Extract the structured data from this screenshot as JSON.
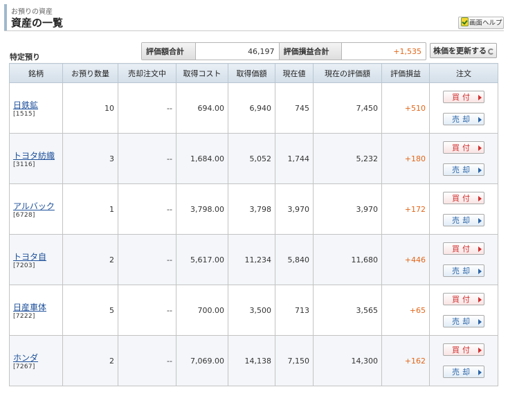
{
  "header": {
    "subtitle": "お預りの資産",
    "title": "資産の一覧",
    "help_label": "画面ヘルプ"
  },
  "section_label": "特定預り",
  "summary": {
    "valuation_total_label": "評価額合計",
    "valuation_total_value": "46,197",
    "pl_total_label": "評価損益合計",
    "pl_total_value": "+1,535"
  },
  "refresh_label": "株価を更新する",
  "colors": {
    "profit": "#e2661a",
    "link": "#1d4f9a",
    "buy": "#d03030",
    "sell": "#2a64a8"
  },
  "table": {
    "headers": [
      "銘柄",
      "お預り数量",
      "売却注文中",
      "取得コスト",
      "取得価額",
      "現在値",
      "現在の評価額",
      "評価損益",
      "注文"
    ],
    "buy_label": "買付",
    "sell_label": "売却",
    "rows": [
      {
        "name": "日鉄鉱",
        "code": "[1515]",
        "qty": "10",
        "pending": "--",
        "cost": "694.00",
        "acq_value": "6,940",
        "price": "745",
        "valuation": "7,450",
        "pl": "+510"
      },
      {
        "name": "トヨタ紡織",
        "code": "[3116]",
        "qty": "3",
        "pending": "--",
        "cost": "1,684.00",
        "acq_value": "5,052",
        "price": "1,744",
        "valuation": "5,232",
        "pl": "+180"
      },
      {
        "name": "アルバック",
        "code": "[6728]",
        "qty": "1",
        "pending": "--",
        "cost": "3,798.00",
        "acq_value": "3,798",
        "price": "3,970",
        "valuation": "3,970",
        "pl": "+172"
      },
      {
        "name": "トヨタ自",
        "code": "[7203]",
        "qty": "2",
        "pending": "--",
        "cost": "5,617.00",
        "acq_value": "11,234",
        "price": "5,840",
        "valuation": "11,680",
        "pl": "+446"
      },
      {
        "name": "日産車体",
        "code": "[7222]",
        "qty": "5",
        "pending": "--",
        "cost": "700.00",
        "acq_value": "3,500",
        "price": "713",
        "valuation": "3,565",
        "pl": "+65"
      },
      {
        "name": "ホンダ",
        "code": "[7267]",
        "qty": "2",
        "pending": "--",
        "cost": "7,069.00",
        "acq_value": "14,138",
        "price": "7,150",
        "valuation": "14,300",
        "pl": "+162"
      }
    ]
  }
}
